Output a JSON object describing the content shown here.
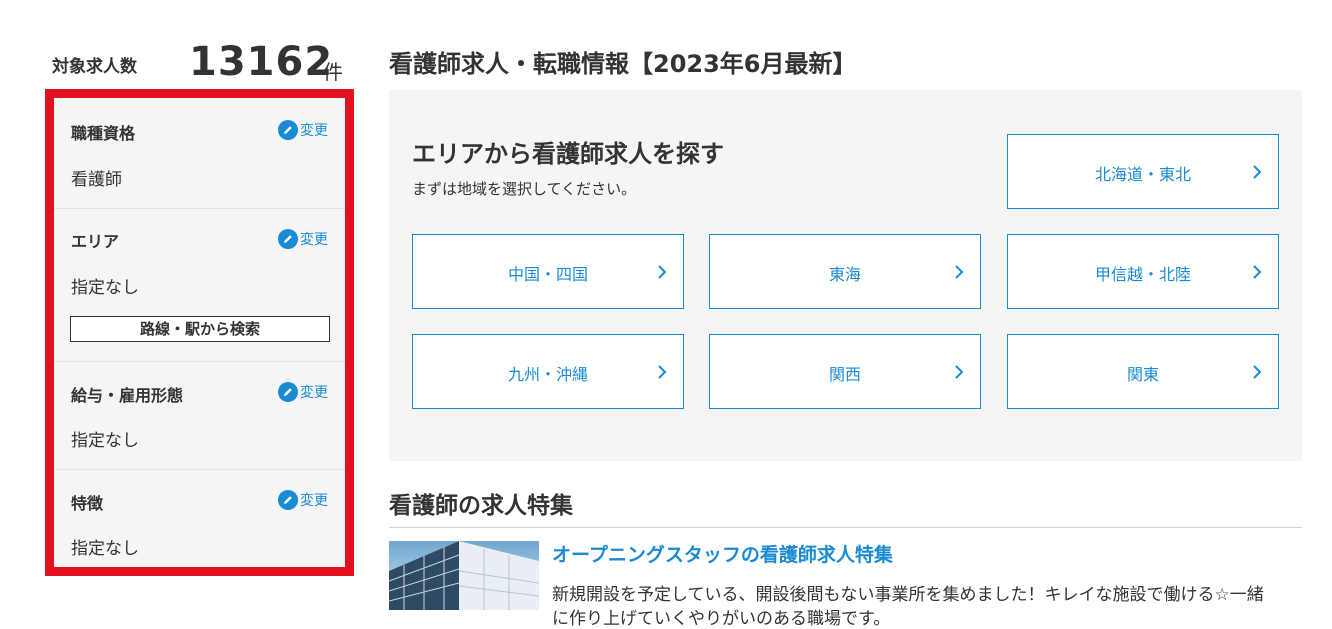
{
  "summary": {
    "label": "対象求人数",
    "count": "13162",
    "unit": "件"
  },
  "filters": {
    "change_label": "変更",
    "occupation": {
      "title": "職種資格",
      "value": "看護師"
    },
    "area": {
      "title": "エリア",
      "value": "指定なし",
      "route_button": "路線・駅から検索"
    },
    "salary": {
      "title": "給与・雇用形態",
      "value": "指定なし"
    },
    "features": {
      "title": "特徴",
      "value": "指定なし"
    }
  },
  "main": {
    "title": "看護師求人・転職情報【2023年6月最新】",
    "area_search": {
      "heading": "エリアから看護師求人を探す",
      "subtext": "まずは地域を選択してください。",
      "regions": [
        "北海道・東北",
        "中国・四国",
        "東海",
        "甲信越・北陸",
        "九州・沖縄",
        "関西",
        "関東"
      ]
    },
    "special": {
      "title": "看護師の求人特集",
      "item_title": "オープニングスタッフの看護師求人特集",
      "item_desc": "新規開設を予定している、開設後間もない事業所を集めました！キレイな施設で働ける☆一緒",
      "item_desc_2": "に作り上げていくやりがいのある職場です。"
    }
  },
  "colors": {
    "accent": "#1a8bd3",
    "highlight_border": "#e1121d",
    "panel_bg": "#f5f5f5"
  },
  "icons": {
    "change": "pencil-icon",
    "region_arrow": "chevron-right-icon"
  }
}
